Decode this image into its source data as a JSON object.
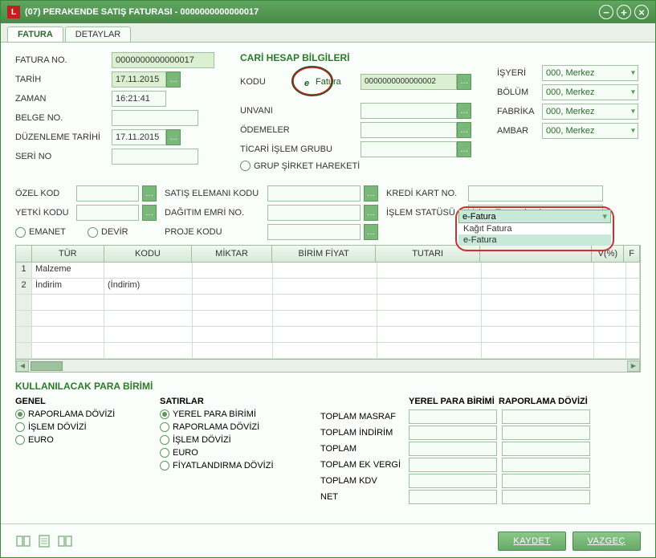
{
  "window": {
    "title": "(07) PERAKENDE SATIŞ FATURASI - 0000000000000017",
    "icon_letter": "L"
  },
  "tabs": {
    "fatura": "FATURA",
    "detaylar": "DETAYLAR"
  },
  "left": {
    "fatura_no_lbl": "FATURA NO.",
    "fatura_no_val": "0000000000000017",
    "tarih_lbl": "TARİH",
    "tarih_val": "17.11.2015",
    "zaman_lbl": "ZAMAN",
    "zaman_val": "16:21:41",
    "belge_no_lbl": "BELGE NO.",
    "belge_no_val": "",
    "duzenleme_lbl": "DÜZENLEME TARİHİ",
    "duzenleme_val": "17.11.2015",
    "seri_no_lbl": "SERİ NO",
    "seri_no_val": ""
  },
  "cari": {
    "title": "CARİ HESAP BİLGİLERİ",
    "kodu_lbl": "KODU",
    "kodu_val": "0000000000000002",
    "unvani_lbl": "UNVANI",
    "unvani_val": "",
    "odemeler_lbl": "ÖDEMELER",
    "odemeler_val": "",
    "ticari_lbl": "TİCARİ İŞLEM GRUBU",
    "ticari_val": "",
    "grup_lbl": "GRUP ŞİRKET HAREKETİ"
  },
  "right": {
    "isyeri_lbl": "İŞYERİ",
    "isyeri_val": "000, Merkez",
    "bolum_lbl": "BÖLÜM",
    "bolum_val": "000, Merkez",
    "fabrika_lbl": "FABRİKA",
    "fabrika_val": "000, Merkez",
    "ambar_lbl": "AMBAR",
    "ambar_val": "000, Merkez"
  },
  "mid": {
    "ozel_kod_lbl": "ÖZEL KOD",
    "yetki_kodu_lbl": "YETKİ KODU",
    "emanet_lbl": "EMANET",
    "devir_lbl": "DEVİR",
    "satis_eleman_lbl": "SATIŞ ELEMANI KODU",
    "dagitim_emri_lbl": "DAĞITIM EMRİ NO.",
    "proje_kodu_lbl": "PROJE KODU",
    "kredi_kart_lbl": "KREDİ KART NO.",
    "islem_statusu_lbl": "İŞLEM STATÜSÜ",
    "islem_statusu_val": "İşlem Tamamlandı"
  },
  "dropdown": {
    "selected": "e-Fatura",
    "opt1": "Kağıt Fatura",
    "opt2": "e-Fatura"
  },
  "grid": {
    "headers": {
      "tur": "TÜR",
      "kodu": "KODU",
      "miktar": "MİKTAR",
      "birim_fiyat": "BİRİM FİYAT",
      "tutari": "TUTARI",
      "kdv": "V(%)",
      "last": "F"
    },
    "rows": [
      {
        "n": "1",
        "tur": "Malzeme",
        "kodu": ""
      },
      {
        "n": "2",
        "tur": "İndirim",
        "kodu": "(İndirim)"
      }
    ]
  },
  "currency": {
    "title": "KULLANILACAK PARA BİRİMİ",
    "genel_lbl": "GENEL",
    "satirlar_lbl": "SATIRLAR",
    "genel": {
      "raporlama": "RAPORLAMA DÖVİZİ",
      "islem": "İŞLEM DÖVİZİ",
      "euro": "EURO"
    },
    "satirlar": {
      "yerel": "YEREL PARA BİRİMİ",
      "raporlama": "RAPORLAMA DÖVİZİ",
      "islem": "İŞLEM DÖVİZİ",
      "euro": "EURO",
      "fiyat": "FİYATLANDIRMA DÖVİZİ"
    }
  },
  "totals": {
    "col1_lbl": "YEREL PARA BİRİMİ",
    "col2_lbl": "RAPORLAMA DÖVİZİ",
    "masraf": "TOPLAM MASRAF",
    "indirim": "TOPLAM İNDİRİM",
    "toplam": "TOPLAM",
    "ek_vergi": "TOPLAM EK VERGİ",
    "kdv": "TOPLAM KDV",
    "net": "NET"
  },
  "footer": {
    "kaydet": "KAYDET",
    "vazgec": "VAZGEÇ"
  }
}
